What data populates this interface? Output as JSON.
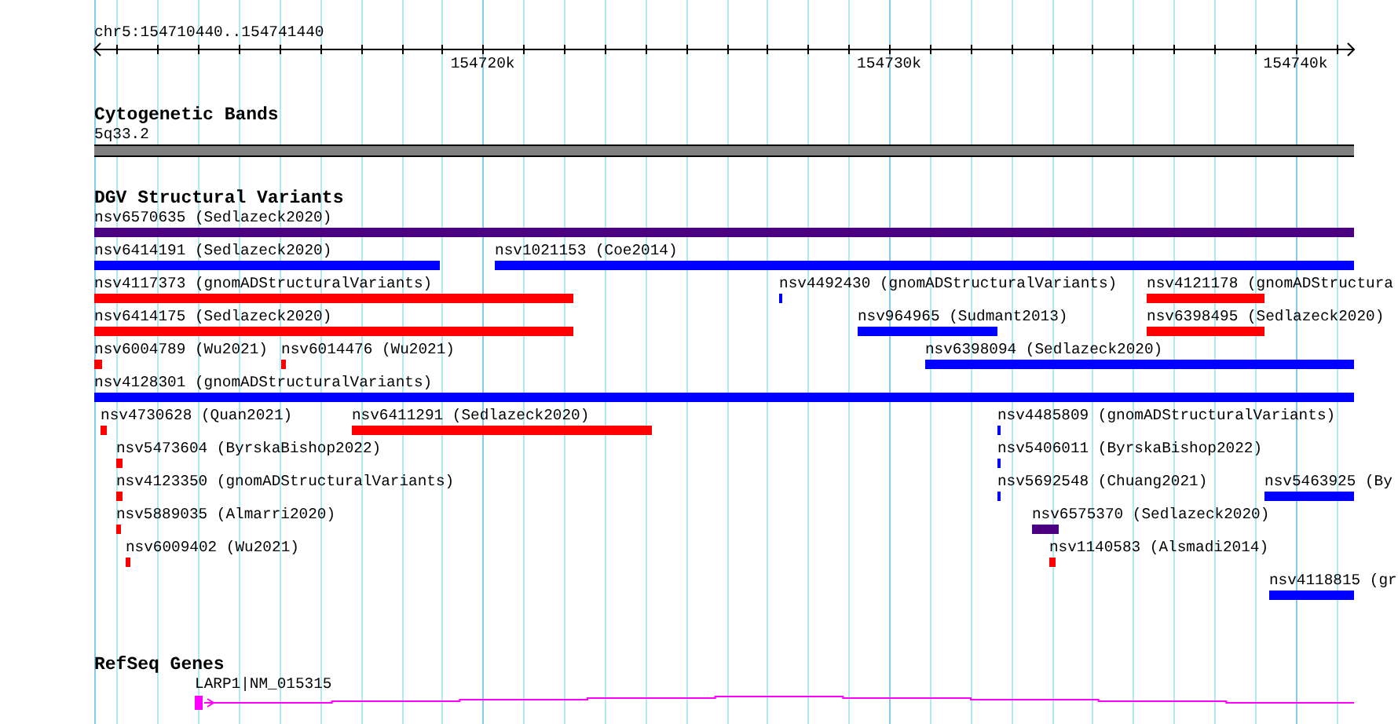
{
  "location": "chr5:154710440..154741440",
  "ruler": {
    "major_ticks": [
      {
        "label": "154720k"
      },
      {
        "label": "154730k"
      },
      {
        "label": "154740k"
      }
    ]
  },
  "tracks": [
    {
      "kind": "cytoband",
      "title": "Cytogenetic Bands",
      "band": {
        "label": "5q33.2"
      }
    },
    {
      "kind": "variants",
      "title": "DGV Structural Variants",
      "rows": [
        {
          "features": [
            {
              "label": "nsv6570635 (Sedlazeck2020)",
              "color": "#4b0082"
            }
          ]
        },
        {
          "features": [
            {
              "label": "nsv6414191 (Sedlazeck2020)",
              "color": "#0000ff"
            },
            {
              "label": "nsv1021153 (Coe2014)",
              "color": "#0000ff"
            }
          ]
        },
        {
          "features": [
            {
              "label": "nsv4117373 (gnomADStructuralVariants)",
              "color": "#ff0000"
            },
            {
              "label": "nsv4492430 (gnomADStructuralVariants)",
              "color": "#0000ff"
            },
            {
              "label": "nsv4121178 (gnomADStructura",
              "color": "#ff0000"
            }
          ]
        },
        {
          "features": [
            {
              "label": "nsv6414175 (Sedlazeck2020)",
              "color": "#ff0000"
            },
            {
              "label": "nsv964965 (Sudmant2013)",
              "color": "#0000ff"
            },
            {
              "label": "nsv6398495 (Sedlazeck2020)",
              "color": "#ff0000"
            }
          ]
        },
        {
          "features": [
            {
              "label": "nsv6004789 (Wu2021)",
              "color": "#ff0000"
            },
            {
              "label": "nsv6014476 (Wu2021)",
              "color": "#ff0000"
            },
            {
              "label": "nsv6398094 (Sedlazeck2020)",
              "color": "#0000ff"
            }
          ]
        },
        {
          "features": [
            {
              "label": "nsv4128301 (gnomADStructuralVariants)",
              "color": "#0000ff"
            }
          ]
        },
        {
          "features": [
            {
              "label": "nsv4730628 (Quan2021)",
              "color": "#ff0000"
            },
            {
              "label": "nsv6411291 (Sedlazeck2020)",
              "color": "#ff0000"
            },
            {
              "label": "nsv4485809 (gnomADStructuralVariants)",
              "color": "#0000ff"
            }
          ]
        },
        {
          "features": [
            {
              "label": "nsv5473604 (ByrskaBishop2022)",
              "color": "#ff0000"
            },
            {
              "label": "nsv5406011 (ByrskaBishop2022)",
              "color": "#0000ff"
            }
          ]
        },
        {
          "features": [
            {
              "label": "nsv4123350 (gnomADStructuralVariants)",
              "color": "#ff0000"
            },
            {
              "label": "nsv5692548 (Chuang2021)",
              "color": "#0000ff"
            },
            {
              "label": "nsv5463925 (By",
              "color": "#0000ff"
            }
          ]
        },
        {
          "features": [
            {
              "label": "nsv5889035 (Almarri2020)",
              "color": "#ff0000"
            },
            {
              "label": "nsv6575370 (Sedlazeck2020)",
              "color": "#4b0082"
            }
          ]
        },
        {
          "features": [
            {
              "label": "nsv6009402 (Wu2021)",
              "color": "#ff0000"
            },
            {
              "label": "nsv1140583 (Alsmadi2014)",
              "color": "#ff0000"
            }
          ]
        },
        {
          "features": [
            {
              "label": "nsv4118815 (gr",
              "color": "#0000ff"
            }
          ]
        }
      ]
    },
    {
      "kind": "genes",
      "title": "RefSeq Genes",
      "genes": [
        {
          "label": "LARP1|NM_015315"
        }
      ]
    }
  ]
}
